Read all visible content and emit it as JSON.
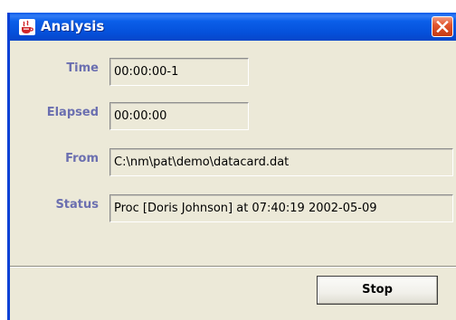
{
  "window": {
    "title": "Analysis",
    "title_icon": "java-cup-icon",
    "close_icon": "close-icon",
    "colors": {
      "titlebar": "#0551db",
      "close_button": "#e2562e",
      "background": "#ece9d8",
      "label_text": "#6b6fb0"
    }
  },
  "fields": {
    "time": {
      "label": "Time",
      "value": "00:00:00-1"
    },
    "elapsed": {
      "label": "Elapsed",
      "value": "00:00:00"
    },
    "from": {
      "label": "From",
      "value": "C:\\nm\\pat\\demo\\datacard.dat"
    },
    "status": {
      "label": "Status",
      "value": "Proc [Doris Johnson] at 07:40:19 2002-05-09"
    }
  },
  "actions": {
    "stop_label": "Stop"
  }
}
